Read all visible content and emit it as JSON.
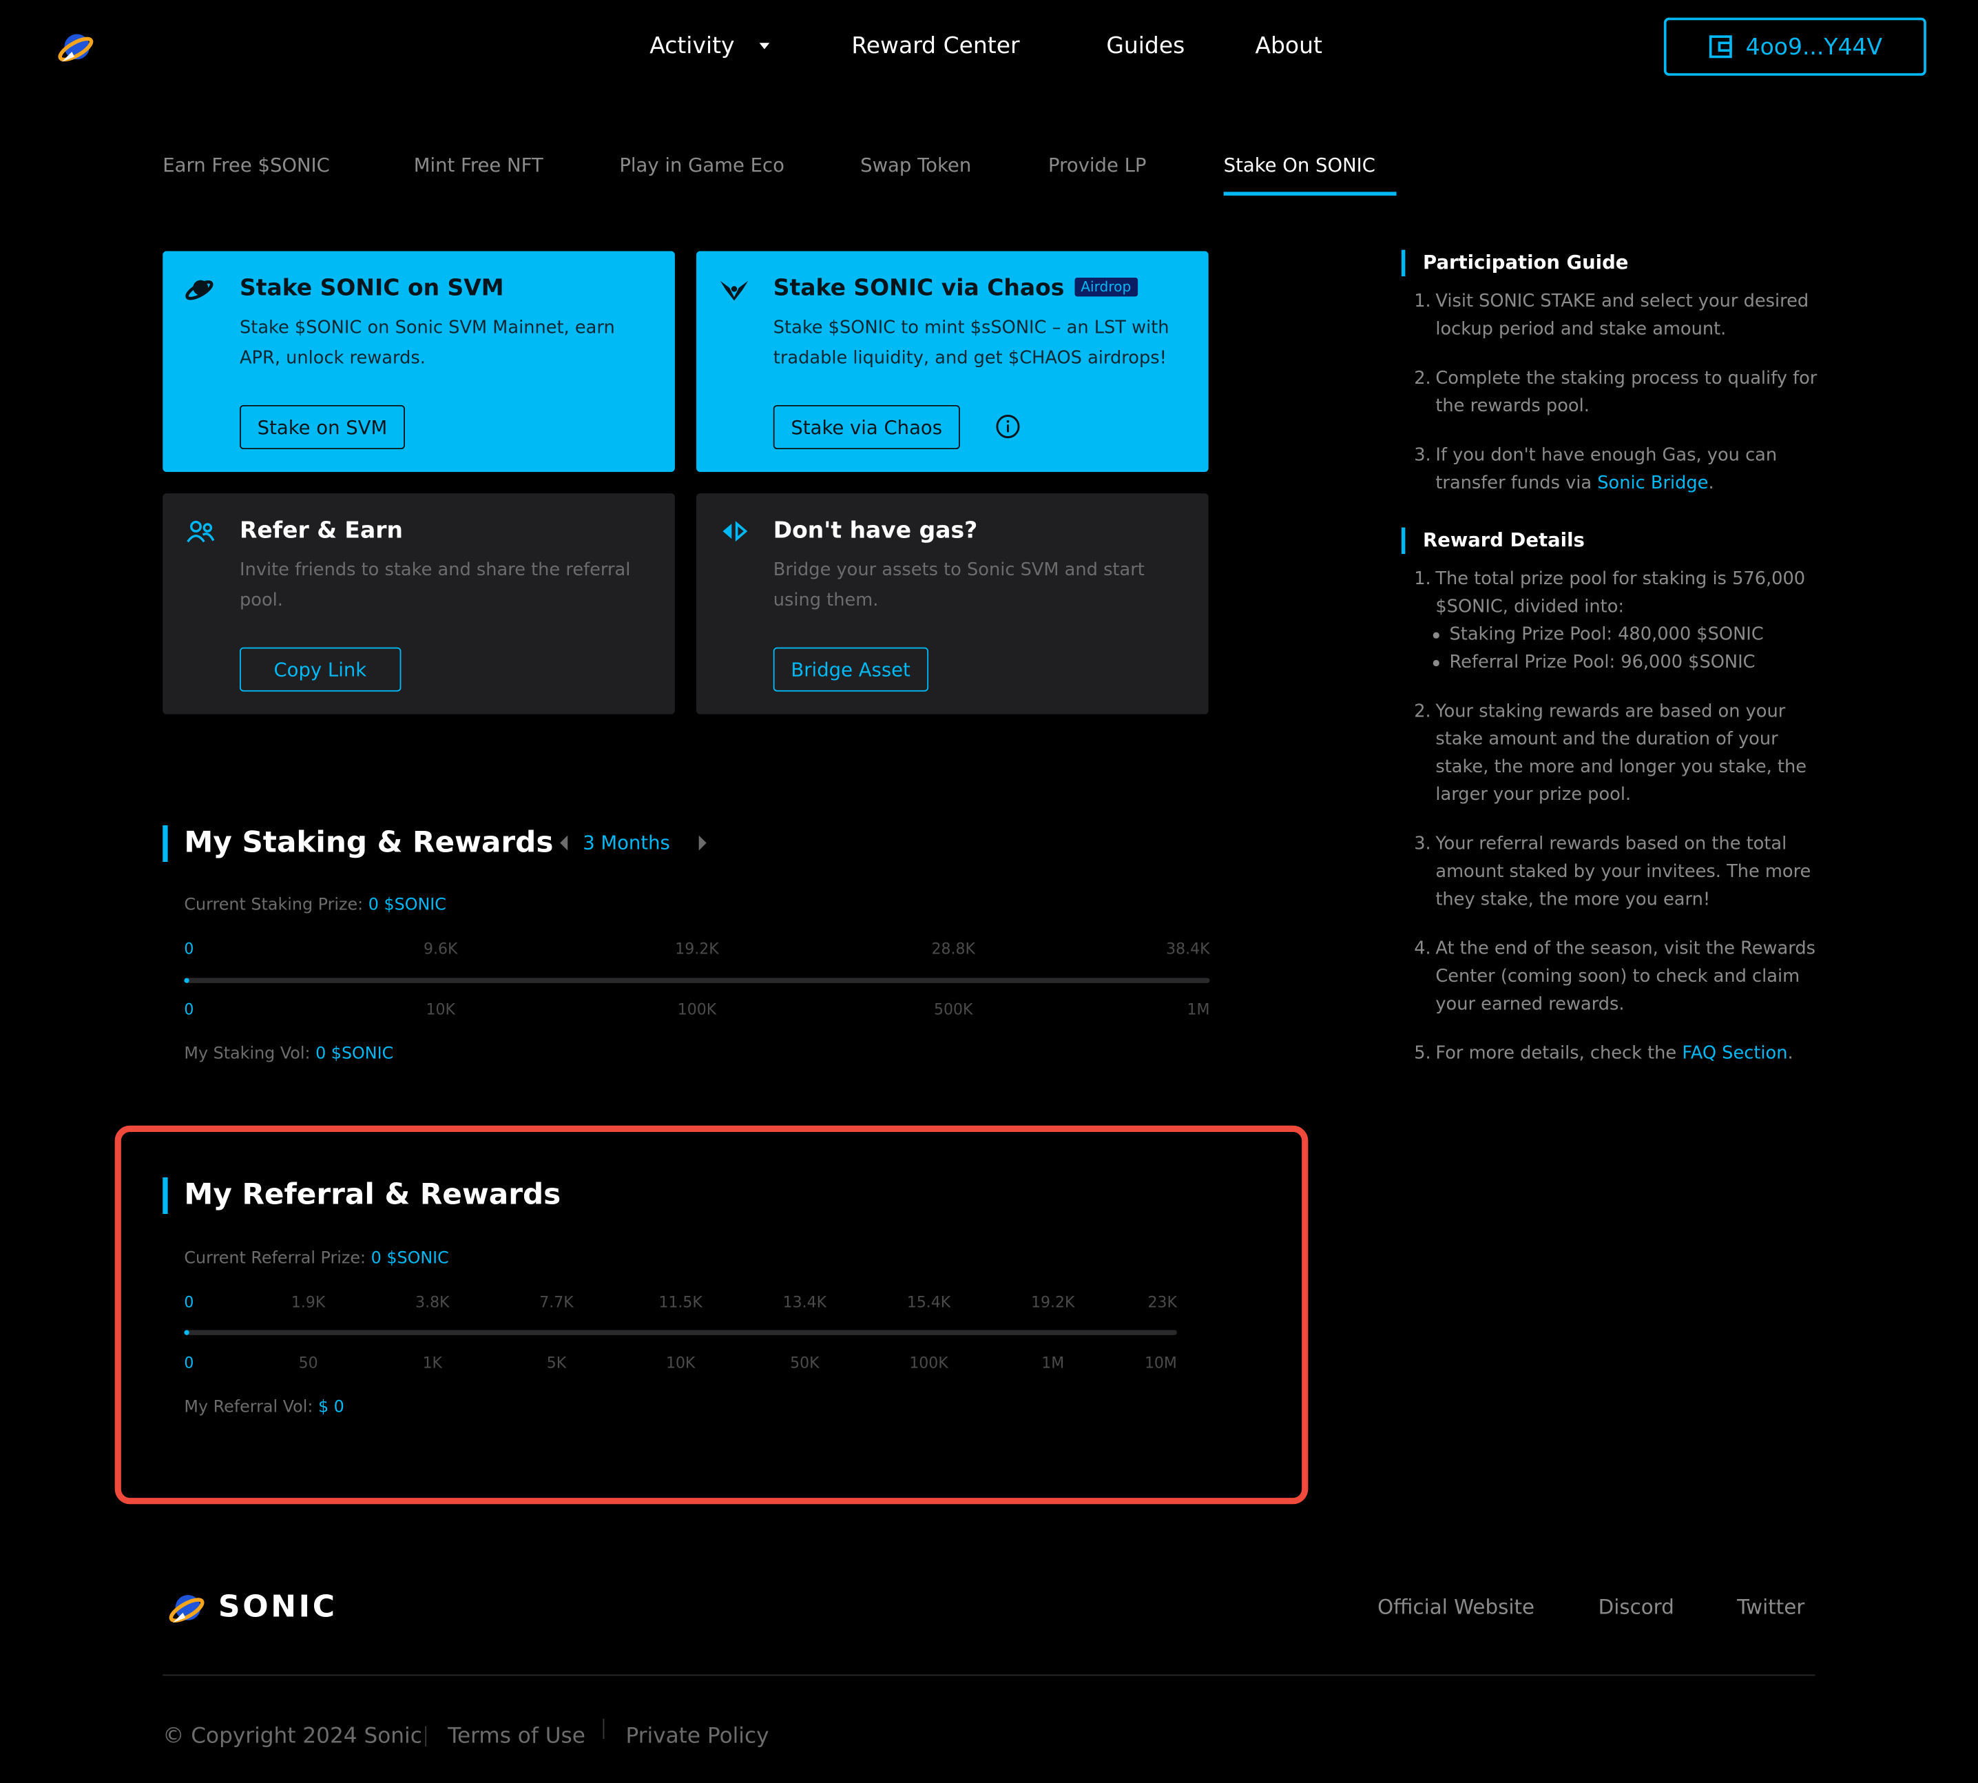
{
  "nav": {
    "items": [
      "Activity",
      "Reward Center",
      "Guides",
      "About"
    ],
    "wallet": "4oo9...Y44V"
  },
  "tabs": [
    "Earn Free $SONIC",
    "Mint Free NFT",
    "Play in Game Eco",
    "Swap Token",
    "Provide LP",
    "Stake On SONIC"
  ],
  "active_tab": "Stake On SONIC",
  "cards": {
    "svm": {
      "title": "Stake SONIC on SVM",
      "desc": "Stake $SONIC on Sonic SVM Mainnet, earn APR, unlock rewards.",
      "button": "Stake on SVM"
    },
    "chaos": {
      "title": "Stake SONIC via Chaos",
      "badge": "Airdrop",
      "desc": "Stake $SONIC to mint $sSONIC – an LST with tradable liquidity, and get $CHAOS airdrops!",
      "button": "Stake via Chaos"
    },
    "refer": {
      "title": "Refer & Earn",
      "desc": "Invite friends to stake and share the referral pool.",
      "button": "Copy Link"
    },
    "gas": {
      "title": "Don't have gas?",
      "desc": "Bridge your assets to Sonic SVM and start using them.",
      "button": "Bridge Asset"
    }
  },
  "staking": {
    "title": "My Staking & Rewards",
    "period": "3 Months",
    "prize_label": "Current Staking Prize:",
    "prize_value": "0 $SONIC",
    "top_ticks": [
      "0",
      "9.6K",
      "19.2K",
      "28.8K",
      "38.4K"
    ],
    "bottom_ticks": [
      "0",
      "10K",
      "100K",
      "500K",
      "1M"
    ],
    "vol_label": "My Staking Vol:",
    "vol_value": "0 $SONIC",
    "progress": 0
  },
  "referral": {
    "title": "My Referral & Rewards",
    "prize_label": "Current Referral Prize:",
    "prize_value": "0 $SONIC",
    "top_ticks": [
      "0",
      "1.9K",
      "3.8K",
      "7.7K",
      "11.5K",
      "13.4K",
      "15.4K",
      "19.2K",
      "23K"
    ],
    "bottom_ticks": [
      "0",
      "50",
      "1K",
      "5K",
      "10K",
      "50K",
      "100K",
      "1M",
      "10M"
    ],
    "vol_label": "My Referral Vol:",
    "vol_value": "$ 0",
    "progress": 0
  },
  "guide": {
    "participation_title": "Participation Guide",
    "p1": "Visit SONIC STAKE and select your desired lockup period and stake amount.",
    "p2": "Complete the staking process to qualify for the rewards pool.",
    "p3_pre": "If you don't have enough Gas, you can transfer funds via ",
    "p3_link": "Sonic Bridge",
    "p3_post": ".",
    "reward_title": "Reward Details",
    "r1": "The total prize pool for staking is 576,000 $SONIC, divided into:",
    "r1_b1": "Staking Prize Pool: 480,000 $SONIC",
    "r1_b2": "Referral Prize Pool: 96,000 $SONIC",
    "r2": "Your staking rewards are based on your stake amount and the duration of your stake, the more and longer you stake, the larger your prize pool.",
    "r3": "Your referral rewards based on the total amount staked by your invitees. The more they stake, the more you earn!",
    "r4": "At the end of the season, visit the Rewards Center (coming soon) to check and claim your earned rewards.",
    "r5_pre": "For more details, check the ",
    "r5_link": "FAQ Section",
    "r5_post": "."
  },
  "footer": {
    "brand": "SONIC",
    "links": [
      "Official Website",
      "Discord",
      "Twitter"
    ],
    "copyright": "© Copyright 2024 Sonic",
    "terms": "Terms of Use",
    "privacy": "Private Policy"
  },
  "colors": {
    "accent": "#00b8f4",
    "card_blue": "#00baf5",
    "highlight": "#f04a3c"
  },
  "icons": [
    "sonic-logo-icon",
    "chevron-down-icon",
    "wallet-icon",
    "ufo-icon",
    "chaos-wings-icon",
    "people-icon",
    "bridge-arrows-icon",
    "info-icon",
    "chevron-left-icon",
    "chevron-right-icon"
  ]
}
